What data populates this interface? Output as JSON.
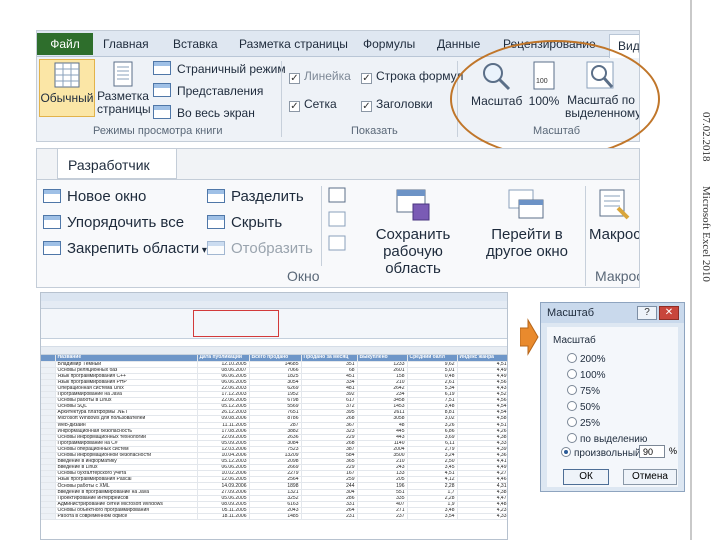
{
  "side": {
    "date": "07.02.2018",
    "app": "Microsoft Excel 2010"
  },
  "ribbon_view": {
    "tabs": [
      "Файл",
      "Главная",
      "Вставка",
      "Разметка страницы",
      "Формулы",
      "Данные",
      "Рецензирование",
      "Вид"
    ],
    "normal_label": "Обычный",
    "page_layout_label": "Разметка страницы",
    "page_mode": "Страничный режим",
    "views": "Представления",
    "fullscreen": "Во весь экран",
    "group_modes": "Режимы просмотра книги",
    "ruler": "Линейка",
    "formula_bar": "Строка формул",
    "grid": "Сетка",
    "headings": "Заголовки",
    "group_show": "Показать",
    "zoom": "Масштаб",
    "zoom100": "100%",
    "zoom_sel": "Масштаб по выделенному",
    "group_zoom": "Масштаб"
  },
  "ribbon_window": {
    "dev_tab": "Разработчик",
    "new_window": "Новое окно",
    "arrange_all": "Упорядочить все",
    "freeze": "Закрепить области",
    "split": "Разделить",
    "hide": "Скрыть",
    "unhide": "Отобразить",
    "save_ws": "Сохранить рабочую область",
    "switch": "Перейти в другое окно",
    "group_window": "Окно",
    "macros": "Макросы",
    "group_macros": "Макросы"
  },
  "sheet": {
    "header": [
      "Название",
      "Дата публикации",
      "Всего продано",
      "Продано за месяц",
      "Выкуплено",
      "Средний балл",
      "Индекс жанра"
    ],
    "rows": [
      [
        "Владимир Тёмный",
        "12.10.2005",
        "14685",
        "351",
        "1233",
        "9,62",
        "4,51"
      ],
      [
        "Основы реляционных баз",
        "08.06.2007",
        "7066",
        "68",
        "2601",
        "5,01",
        "4,49"
      ],
      [
        "Язык программирования C++",
        "06.06.2005",
        "1825",
        "451",
        "158",
        "0,48",
        "4,49"
      ],
      [
        "Язык программирования PHP",
        "06.06.2005",
        "3054",
        "334",
        "210",
        "2,61",
        "4,56"
      ],
      [
        "Операционная система Unix",
        "22.06.2003",
        "6269",
        "481",
        "2642",
        "5,34",
        "4,43"
      ],
      [
        "Программирование на Java",
        "17.12.2003",
        "1952",
        "392",
        "234",
        "6,19",
        "4,52"
      ],
      [
        "Основы работы в Linux",
        "22.06.2005",
        "6798",
        "617",
        "3458",
        "7,51",
        "4,56"
      ],
      [
        "Основы SQL",
        "05.12.2005",
        "5569",
        "372",
        "1453",
        "3,48",
        "4,54"
      ],
      [
        "Архитектура платформы .NET",
        "26.12.2003",
        "7651",
        "395",
        "2611",
        "8,81",
        "4,54"
      ],
      [
        "Microsoft Windows для пользователей",
        "09.08.2006",
        "8786",
        "268",
        "3058",
        "3,02",
        "4,58"
      ],
      [
        "Web-дизайн",
        "11.11.2005",
        "287",
        "367",
        "48",
        "3,26",
        "4,51"
      ],
      [
        "Информационная безопасность",
        "17.08.2006",
        "3882",
        "323",
        "445",
        "6,86",
        "4,26"
      ],
      [
        "Основы информационных технологий",
        "22.09.2005",
        "2636",
        "229",
        "443",
        "3,69",
        "4,38"
      ],
      [
        "Программирование на C#",
        "05.09.2005",
        "3084",
        "268",
        "1140",
        "6,11",
        "4,33"
      ],
      [
        "Основы операционных систем",
        "12.03.2006",
        "7523",
        "387",
        "2004",
        "2,79",
        "4,39"
      ],
      [
        "Основы информационной безопасности",
        "10.04.2006",
        "13209",
        "584",
        "3500",
        "3,24",
        "4,36"
      ],
      [
        "Введение в информатику",
        "05.12.2003",
        "2098",
        "365",
        "210",
        "2,50",
        "4,41"
      ],
      [
        "Введение в Linux",
        "06.06.2005",
        "2669",
        "229",
        "243",
        "3,45",
        "4,49"
      ],
      [
        "Основы бухгалтерского учета",
        "10.02.2006",
        "2279",
        "167",
        "133",
        "4,51",
        "4,27"
      ],
      [
        "Язык программирования Pascal",
        "12.06.2005",
        "2564",
        "259",
        "205",
        "4,12",
        "4,46"
      ],
      [
        "Основы работы с XML",
        "14.09.2006",
        "1898",
        "244",
        "196",
        "2,28",
        "4,31"
      ],
      [
        "Введение в программирование на Java",
        "27.09.2006",
        "1321",
        "304",
        "551",
        "1,7",
        "4,38"
      ],
      [
        "Проектирование интерфейсов",
        "05.06.2005",
        "3252",
        "286",
        "335",
        "2,28",
        "4,47"
      ],
      [
        "Администрирование сетей Microsoft Windows",
        "08.09.2005",
        "6163",
        "331",
        "407",
        "1,9",
        "4,48"
      ],
      [
        "Основы объектного программирования",
        "05.11.2005",
        "2043",
        "264",
        "271",
        "3,48",
        "4,23"
      ],
      [
        "Работа в современном офисе",
        "18.11.2006",
        "1485",
        "231",
        "237",
        "3,54",
        "4,33"
      ]
    ]
  },
  "dialog": {
    "title": "Масштаб",
    "fieldset": "Масштаб",
    "options": [
      "200%",
      "100%",
      "75%",
      "50%",
      "25%",
      "по выделению",
      "произвольный:"
    ],
    "custom_value": "90",
    "pct_sign": "%",
    "ok": "ОК",
    "cancel": "Отмена",
    "help": "?",
    "close": "✕"
  }
}
